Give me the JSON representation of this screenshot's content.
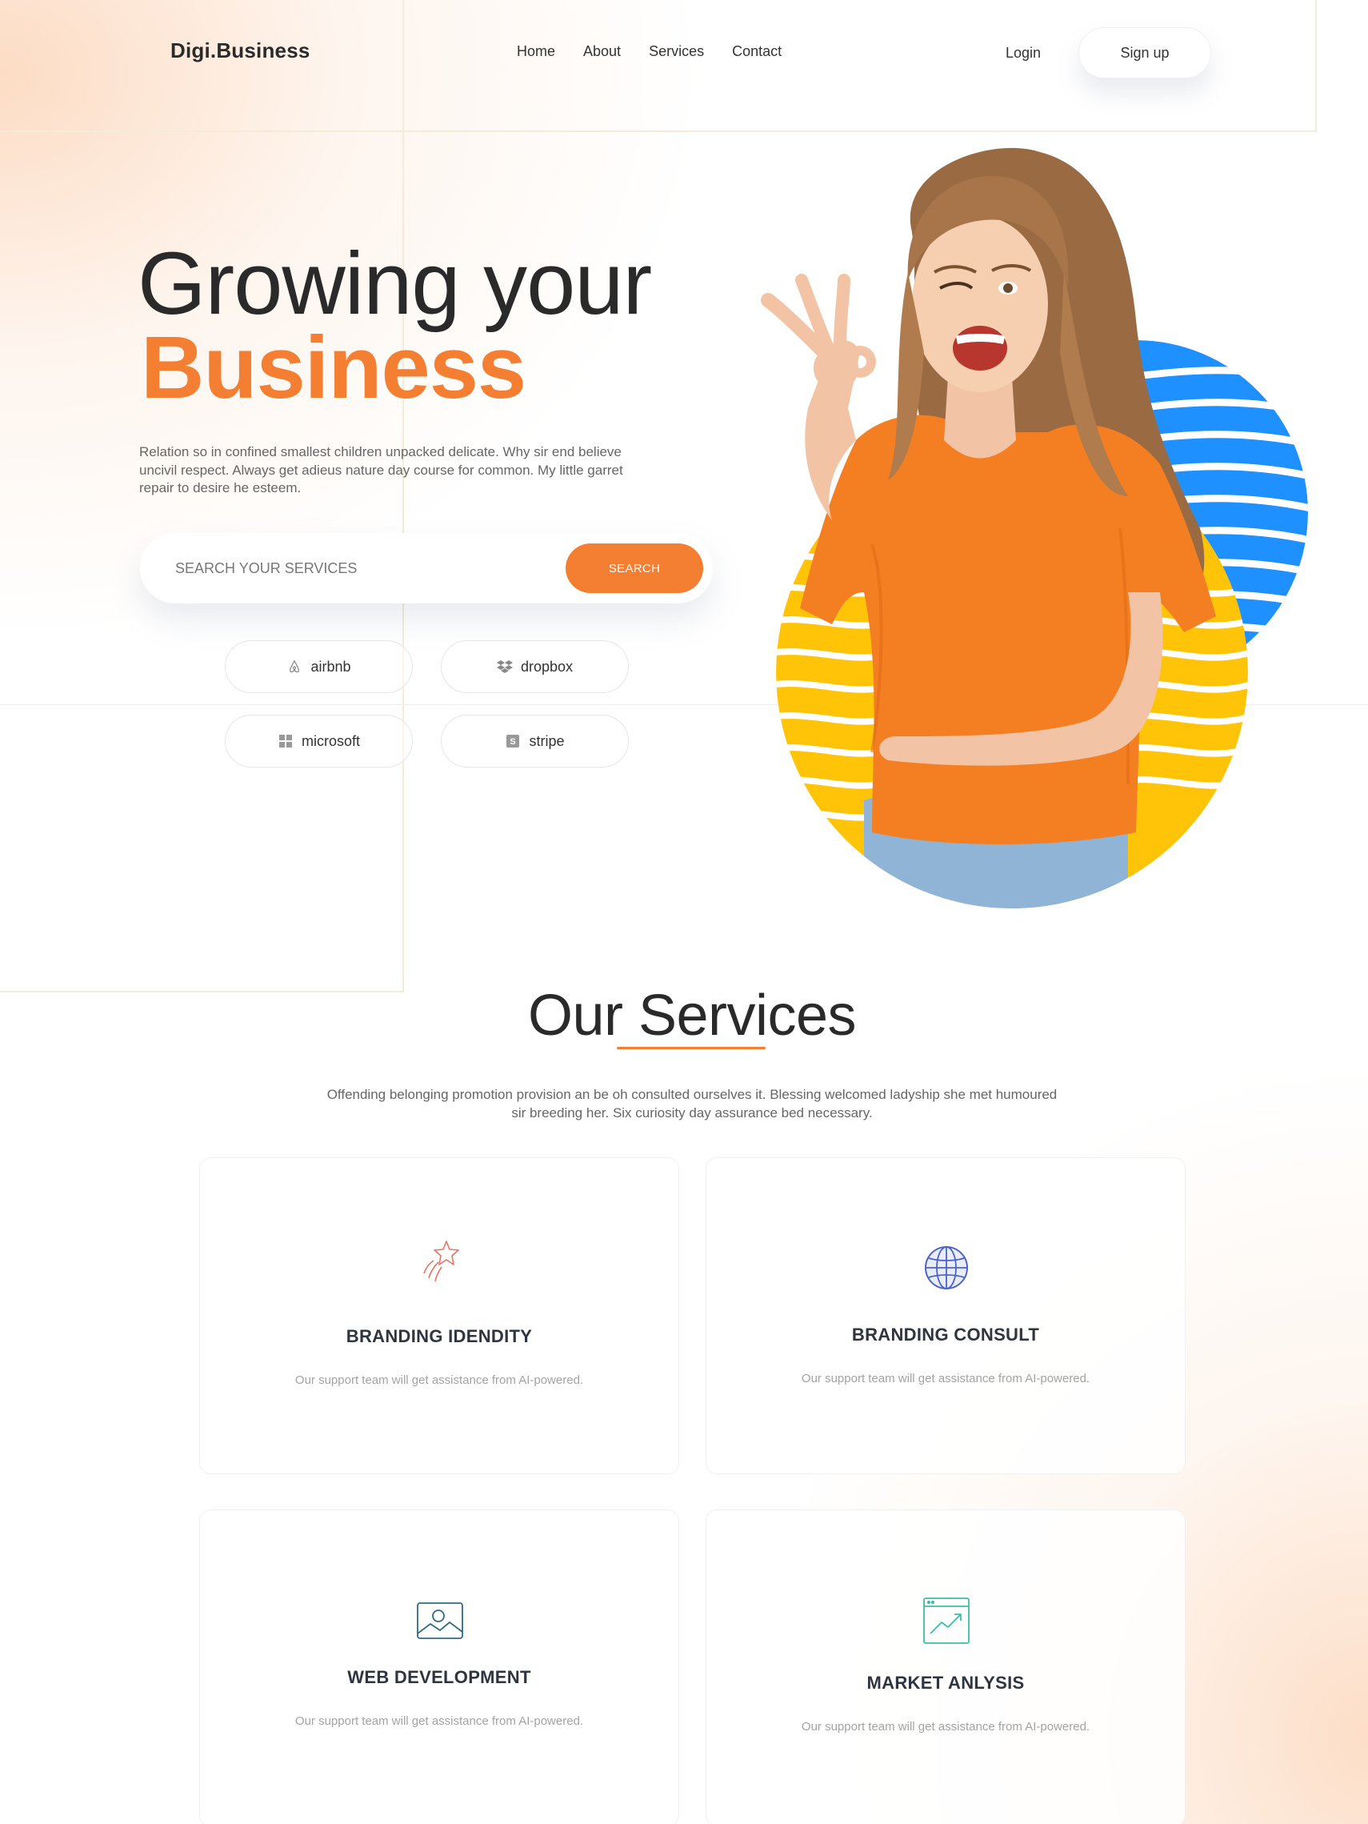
{
  "brand": {
    "logo": "Digi.Business"
  },
  "nav": {
    "items": [
      "Home",
      "About",
      "Services",
      "Contact"
    ],
    "login": "Login",
    "signup": "Sign up"
  },
  "hero": {
    "title_line1": "Growing your",
    "title_line2": "Business",
    "description": "Relation so in confined smallest children unpacked delicate. Why sir end believe uncivil respect. Always get adieus nature day course for common. My little garret repair to desire he esteem.",
    "search": {
      "placeholder": "SEARCH YOUR SERVICES",
      "button": "SEARCH"
    },
    "brands": [
      {
        "label": "airbnb",
        "icon": "airbnb-icon"
      },
      {
        "label": "dropbox",
        "icon": "dropbox-icon"
      },
      {
        "label": "microsoft",
        "icon": "microsoft-icon"
      },
      {
        "label": "stripe",
        "icon": "stripe-icon"
      }
    ]
  },
  "services": {
    "title": "Our Services",
    "description": "Offending belonging promotion provision an be oh consulted ourselves it. Blessing welcomed ladyship she met humoured sir breeding her. Six curiosity day assurance bed necessary.",
    "cards": [
      {
        "title": "BRANDING IDENDITY",
        "description": "Our support team will get assistance from AI-powered.",
        "icon": "shooting-star-icon"
      },
      {
        "title": "BRANDING CONSULT",
        "description": "Our support team will get assistance from AI-powered.",
        "icon": "globe-icon"
      },
      {
        "title": "WEB DEVELOPMENT",
        "description": "Our support team will get assistance from AI-powered.",
        "icon": "image-icon"
      },
      {
        "title": "MARKET ANLYSIS",
        "description": "Our support team will get assistance from AI-powered.",
        "icon": "chart-trend-icon"
      }
    ]
  },
  "colors": {
    "accent": "#f47f33",
    "blue": "#1e90ff",
    "yellow": "#ffc407",
    "text": "#2a2a2a"
  }
}
